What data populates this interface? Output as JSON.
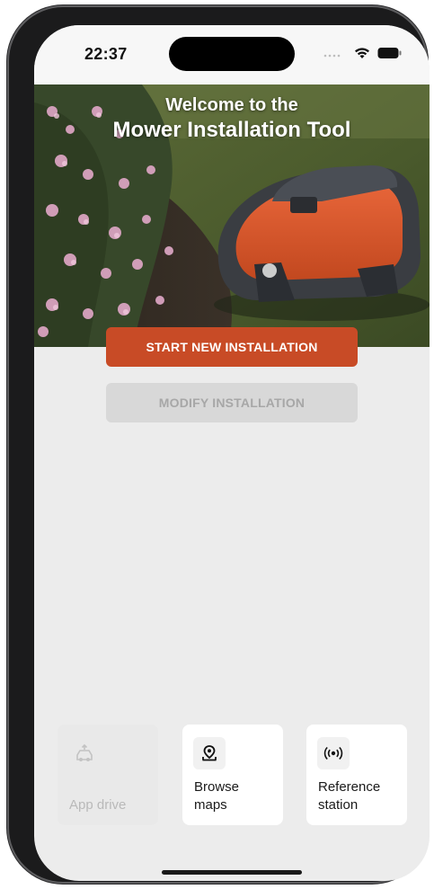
{
  "status_bar": {
    "time": "22:37"
  },
  "hero": {
    "title_line1": "Welcome to the",
    "title_line2": "Mower Installation Tool"
  },
  "actions": {
    "start_label": "START NEW INSTALLATION",
    "modify_label": "MODIFY INSTALLATION"
  },
  "tiles": [
    {
      "label": "App drive",
      "icon": "app-drive-icon",
      "enabled": false
    },
    {
      "label": "Browse\nmaps",
      "icon": "map-pin-icon",
      "enabled": true
    },
    {
      "label": "Reference\nstation",
      "icon": "broadcast-icon",
      "enabled": true
    }
  ],
  "colors": {
    "accent": "#c84b26",
    "disabled_button": "#d8d8d8",
    "background": "#ececec"
  }
}
